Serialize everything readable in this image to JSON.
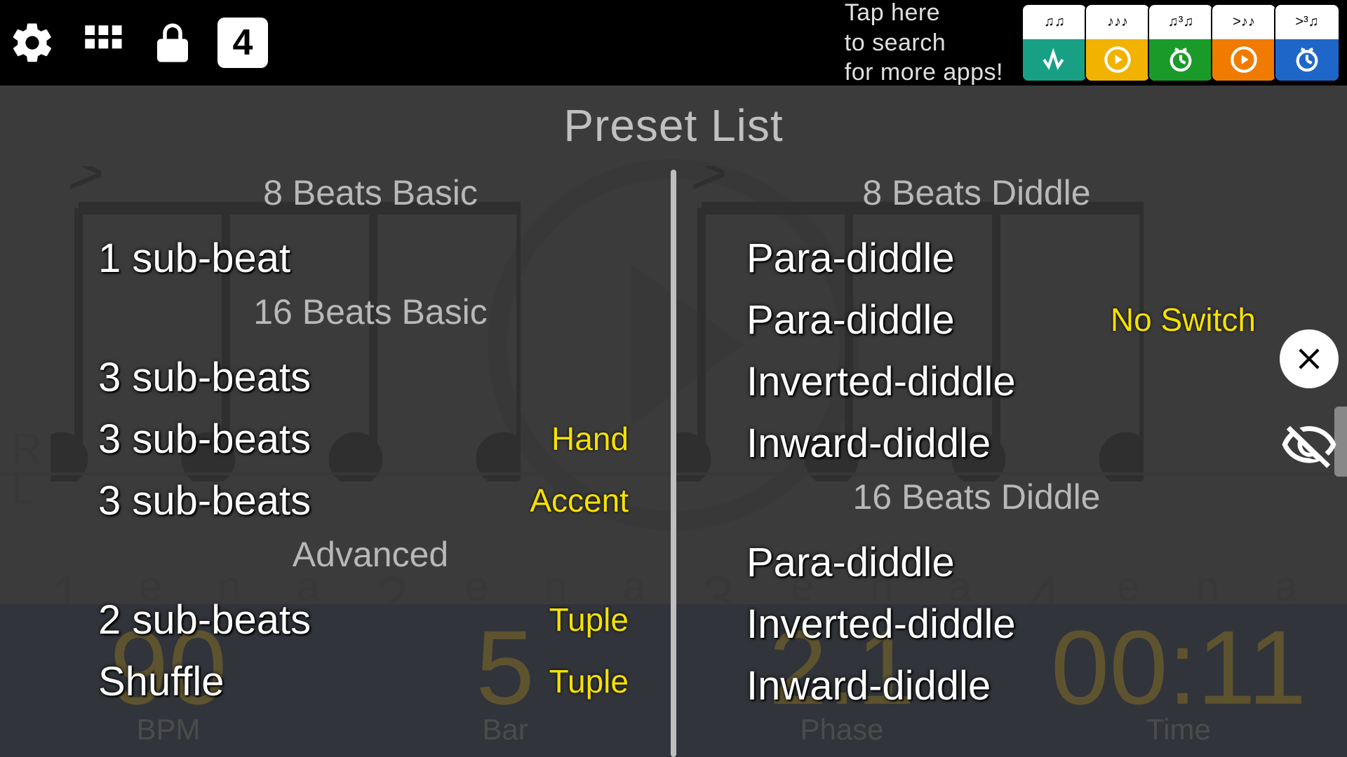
{
  "topbar": {
    "grid_label": "grid",
    "square_value": "4",
    "promo_line1": "Tap here",
    "promo_line2": "to search",
    "promo_line3": "for more apps!"
  },
  "apps": [
    {
      "top_glyph": "♫♫",
      "color": "teal",
      "icon": "tuner"
    },
    {
      "top_glyph": "♪♪♪",
      "color": "amber",
      "icon": "play"
    },
    {
      "top_glyph": "♫³♫",
      "color": "green",
      "icon": "clock"
    },
    {
      "top_glyph": ">♪♪",
      "color": "orange",
      "icon": "play"
    },
    {
      "top_glyph": ">³♫",
      "color": "blue",
      "icon": "clock"
    }
  ],
  "bg": {
    "r": "R",
    "l": "L",
    "beat_syms": [
      "1",
      "e",
      "n",
      "a",
      "2",
      "e",
      "n",
      "a",
      "3",
      "e",
      "n",
      "a",
      "4",
      "e",
      "n",
      "a"
    ]
  },
  "bottom": {
    "bpm_value": "90",
    "bpm_label": "BPM",
    "bar_value": "5",
    "bar_label": "Bar",
    "phase_value": "2.1",
    "phase_label": "Phase",
    "time_value": "00:11",
    "time_label": "Time"
  },
  "preset": {
    "title": "Preset List",
    "left": [
      {
        "type": "header",
        "label": "8 Beats Basic"
      },
      {
        "type": "item",
        "name": "1 sub-beat"
      },
      {
        "type": "header",
        "label": "16 Beats Basic"
      },
      {
        "type": "item",
        "name": "3 sub-beats"
      },
      {
        "type": "item",
        "name": "3 sub-beats",
        "tag": "Hand"
      },
      {
        "type": "item",
        "name": "3 sub-beats",
        "tag": "Accent"
      },
      {
        "type": "header",
        "label": "Advanced"
      },
      {
        "type": "item",
        "name": "2 sub-beats",
        "tag": "Tuple"
      },
      {
        "type": "item",
        "name": "Shuffle",
        "tag": "Tuple"
      }
    ],
    "right": [
      {
        "type": "header",
        "label": "8 Beats Diddle"
      },
      {
        "type": "item",
        "name": "Para-diddle"
      },
      {
        "type": "item",
        "name": "Para-diddle",
        "tag": "No Switch"
      },
      {
        "type": "item",
        "name": "Inverted-diddle"
      },
      {
        "type": "item",
        "name": "Inward-diddle"
      },
      {
        "type": "header",
        "label": "16 Beats Diddle"
      },
      {
        "type": "item",
        "name": "Para-diddle"
      },
      {
        "type": "item",
        "name": "Inverted-diddle"
      },
      {
        "type": "item",
        "name": "Inward-diddle"
      }
    ]
  }
}
